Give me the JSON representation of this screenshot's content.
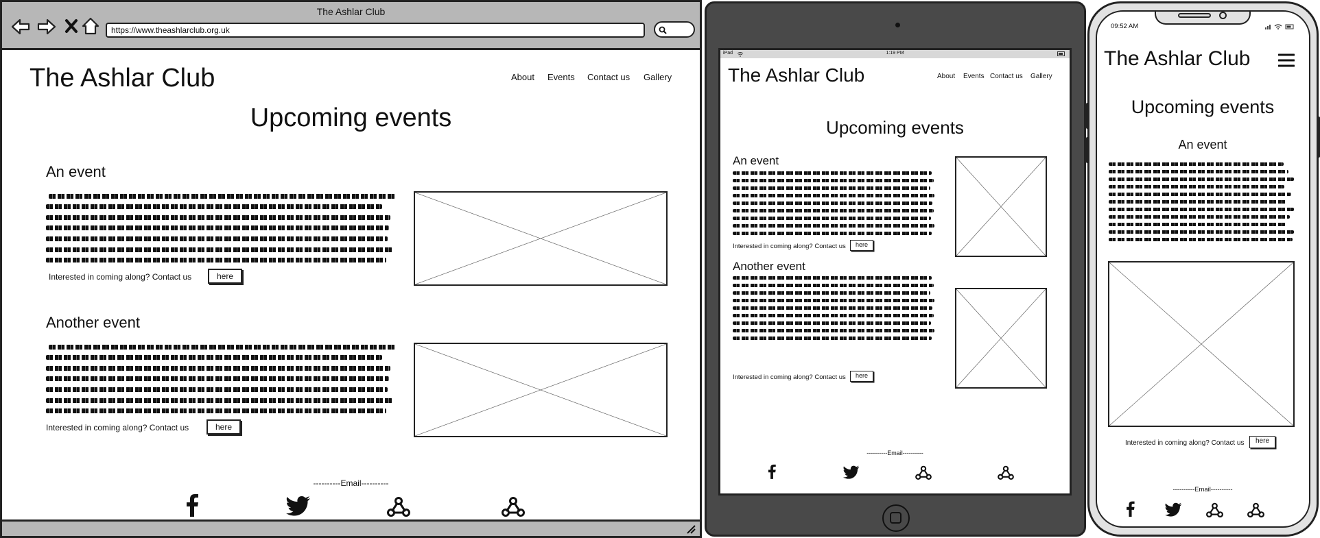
{
  "desktop": {
    "window_title": "The Ashlar Club",
    "url": "https://www.theashlarclub.org.uk",
    "site_title": "The Ashlar Club",
    "nav": [
      "About",
      "Events",
      "Contact us",
      "Gallery"
    ],
    "heading": "Upcoming events",
    "events": [
      {
        "title": "An event",
        "cta_text": "Interested in coming along? Contact us",
        "cta_button": "here"
      },
      {
        "title": "Another event",
        "cta_text": "Interested in coming along? Contact us",
        "cta_button": "here"
      }
    ],
    "footer_email": "----------Email----------",
    "social_icons": [
      "facebook-icon",
      "twitter-icon",
      "webhook-icon",
      "webhook-icon"
    ]
  },
  "tablet": {
    "status_left": "iPad",
    "status_time": "1:19 PM",
    "site_title": "The Ashlar Club",
    "nav": [
      "About",
      "Events",
      "Contact us",
      "Gallery"
    ],
    "heading": "Upcoming events",
    "events": [
      {
        "title": "An event",
        "cta_text": "Interested in coming along? Contact us",
        "cta_button": "here"
      },
      {
        "title": "Another event",
        "cta_text": "Interested in coming along? Contact us",
        "cta_button": "here"
      }
    ],
    "footer_email": "----------Email----------",
    "social_icons": [
      "facebook-icon",
      "twitter-icon",
      "webhook-icon",
      "webhook-icon"
    ]
  },
  "phone": {
    "status_time": "09:52 AM",
    "site_title": "The Ashlar Club",
    "heading": "Upcoming events",
    "event_title": "An event",
    "cta_text": "Interested in coming along? Contact us",
    "cta_button": "here",
    "footer_email": "----------Email----------",
    "social_icons": [
      "facebook-icon",
      "twitter-icon",
      "webhook-icon",
      "webhook-icon"
    ]
  }
}
